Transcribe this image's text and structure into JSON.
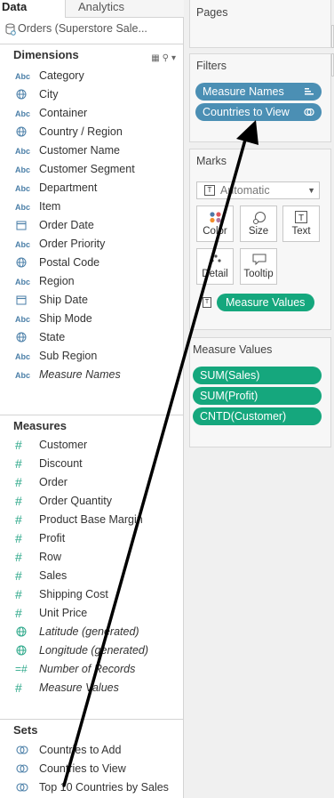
{
  "left": {
    "tabs": {
      "data": "Data",
      "analytics": "Analytics"
    },
    "datasource": "Orders (Superstore Sale...",
    "dimensions_header": "Dimensions",
    "dimensions": [
      {
        "icon": "Abc",
        "label": "Category"
      },
      {
        "icon": "globe",
        "label": "City"
      },
      {
        "icon": "Abc",
        "label": "Container"
      },
      {
        "icon": "globe",
        "label": "Country / Region"
      },
      {
        "icon": "Abc",
        "label": "Customer Name"
      },
      {
        "icon": "Abc",
        "label": "Customer Segment"
      },
      {
        "icon": "Abc",
        "label": "Department"
      },
      {
        "icon": "Abc",
        "label": "Item"
      },
      {
        "icon": "calendar",
        "label": "Order Date"
      },
      {
        "icon": "Abc",
        "label": "Order Priority"
      },
      {
        "icon": "globe",
        "label": "Postal Code"
      },
      {
        "icon": "Abc",
        "label": "Region"
      },
      {
        "icon": "calendar",
        "label": "Ship Date"
      },
      {
        "icon": "Abc",
        "label": "Ship Mode"
      },
      {
        "icon": "globe",
        "label": "State"
      },
      {
        "icon": "Abc",
        "label": "Sub Region"
      },
      {
        "icon": "Abc",
        "label": "Measure Names"
      }
    ],
    "measures_header": "Measures",
    "measures": [
      {
        "icon": "#",
        "label": "Customer"
      },
      {
        "icon": "#",
        "label": "Discount"
      },
      {
        "icon": "#",
        "label": "Order"
      },
      {
        "icon": "#",
        "label": "Order Quantity"
      },
      {
        "icon": "#",
        "label": "Product Base Margin"
      },
      {
        "icon": "#",
        "label": "Profit"
      },
      {
        "icon": "#",
        "label": "Row"
      },
      {
        "icon": "#",
        "label": "Sales"
      },
      {
        "icon": "#",
        "label": "Shipping Cost"
      },
      {
        "icon": "#",
        "label": "Unit Price"
      },
      {
        "icon": "globe",
        "label": "Latitude (generated)"
      },
      {
        "icon": "globe",
        "label": "Longitude (generated)"
      },
      {
        "icon": "=#",
        "label": "Number of Records"
      },
      {
        "icon": "#",
        "label": "Measure Values"
      }
    ],
    "sets_header": "Sets",
    "sets": [
      {
        "icon": "set",
        "label": "Countries to Add"
      },
      {
        "icon": "set",
        "label": "Countries to View"
      },
      {
        "icon": "set",
        "label": "Top 10 Countries by Sales"
      }
    ]
  },
  "right": {
    "pages_title": "Pages",
    "filters_title": "Filters",
    "filters": [
      "Measure Names",
      "Countries to View"
    ],
    "marks_title": "Marks",
    "mark_type": "Automatic",
    "mark_buttons": [
      "Color",
      "Size",
      "Text",
      "Detail",
      "Tooltip"
    ],
    "marks_pill": "Measure Values",
    "measure_values_title": "Measure Values",
    "measure_values": [
      "SUM(Sales)",
      "SUM(Profit)",
      "CNTD(Customer)"
    ]
  },
  "colors": {
    "dimension_pill": "#4b8fb4",
    "measure_pill": "#15a77d",
    "dimension_icon": "#4b7fa8",
    "measure_icon": "#2da88a"
  }
}
